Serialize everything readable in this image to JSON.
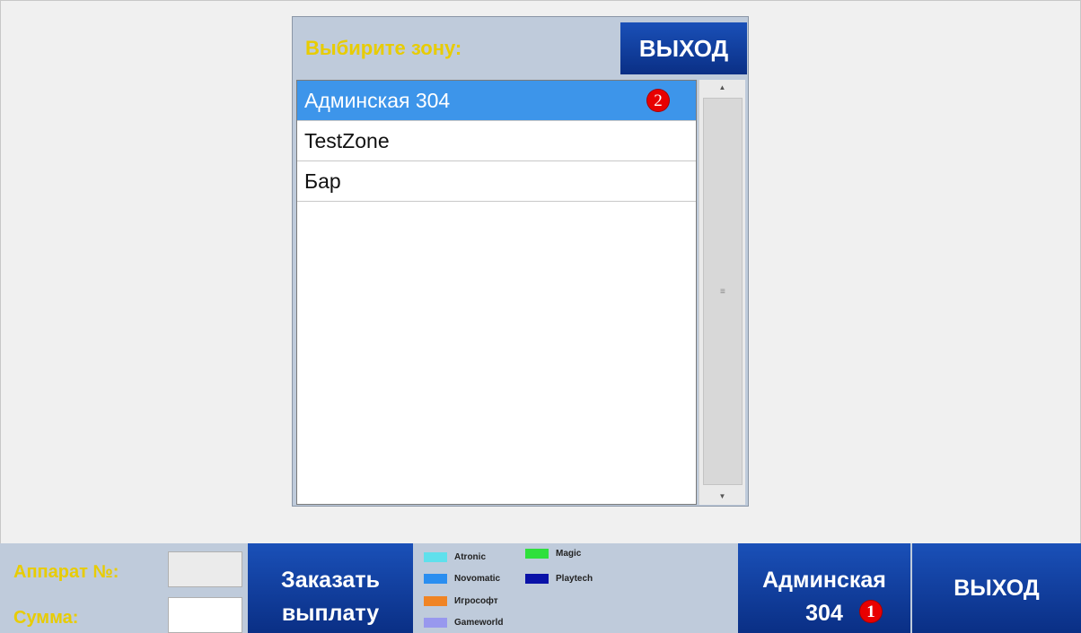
{
  "dialog": {
    "title": "Выбирите зону:",
    "exit_label": "ВЫХОД",
    "zones": [
      {
        "label": "Админская 304",
        "selected": true
      },
      {
        "label": "TestZone",
        "selected": false
      },
      {
        "label": "Бар",
        "selected": false
      }
    ],
    "badge": "2"
  },
  "bottom": {
    "machine_label": "Аппарат №:",
    "machine_value": "",
    "sum_label": "Сумма:",
    "sum_value": "",
    "pay_line1": "Заказать",
    "pay_line2": "выплату",
    "zone_line1": "Админская",
    "zone_line2": "304",
    "zone_badge": "1",
    "exit_label": "ВЫХОД"
  },
  "legend": [
    {
      "label": "Atronic",
      "color": "#5fe0ec"
    },
    {
      "label": "Magic",
      "color": "#2fe03c"
    },
    {
      "label": "Novomatic",
      "color": "#2a8ef0"
    },
    {
      "label": "Playtech",
      "color": "#0a12a8"
    },
    {
      "label": "Игрософт",
      "color": "#f08424"
    },
    {
      "label": "Gameworld",
      "color": "#9898ee"
    }
  ]
}
